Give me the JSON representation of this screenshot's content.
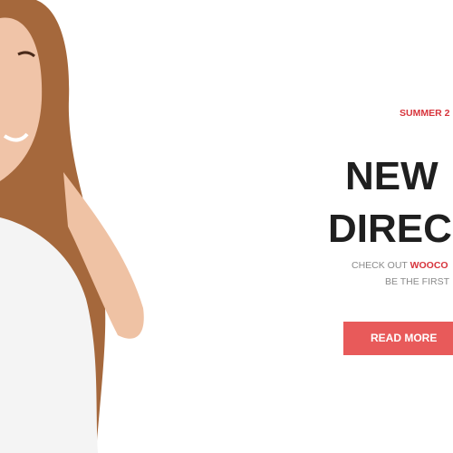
{
  "hero": {
    "kicker": "SUMMER 2",
    "title_line1": "NEW",
    "title_line2": "DIREC",
    "subtitle_prefix": "CHECK OUT ",
    "subtitle_highlight": "WOOCO",
    "subtitle_line2": "BE THE FIRST",
    "button_label": "READ MORE"
  },
  "colors": {
    "accent": "#d7343c",
    "button": "#e85a5a",
    "heading": "#1f1f1f",
    "muted": "#8a8a8a"
  }
}
